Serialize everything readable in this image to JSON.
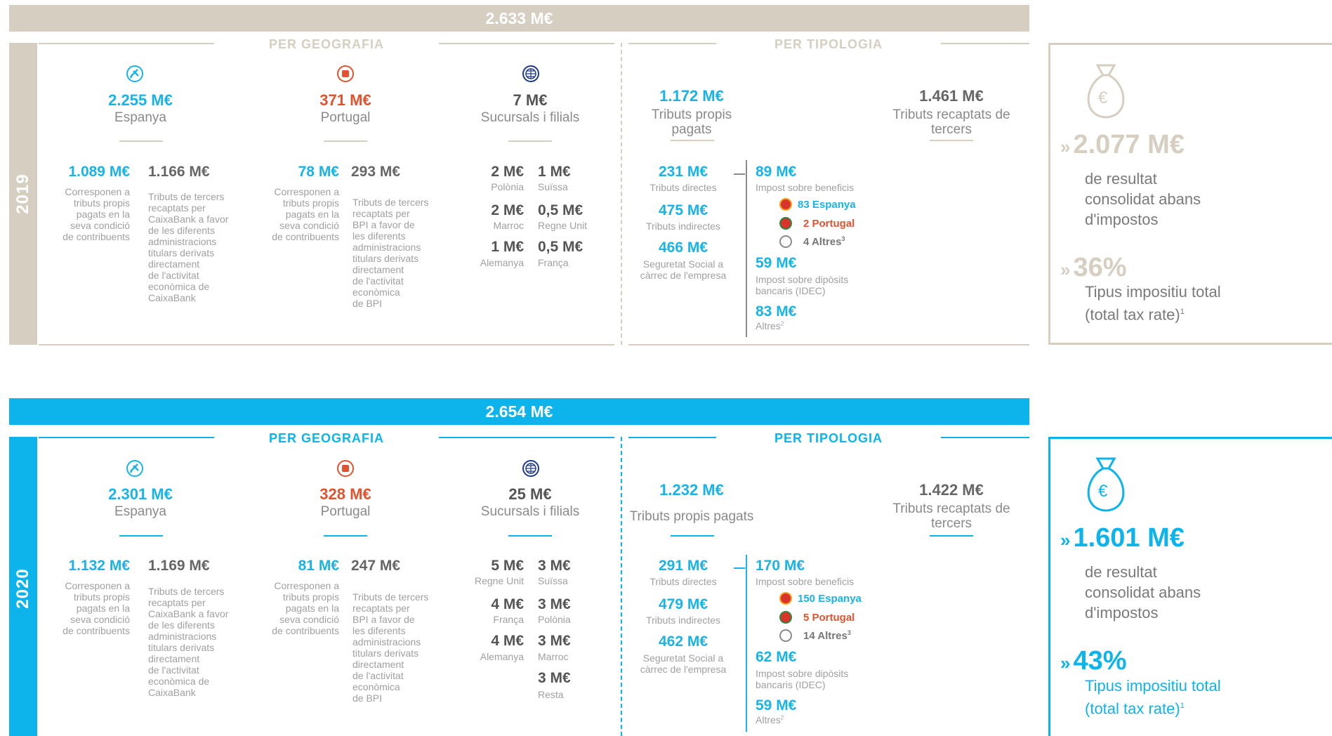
{
  "colors": {
    "y2019": "#d6cec1",
    "y2020": "#0db4ec",
    "blue": "#19b3e8",
    "orange": "#e0532e",
    "dark": "#555555",
    "gray": "#a0a0a0",
    "navy": "#1f3a8a"
  },
  "icons": {
    "spain": "plane-icon",
    "portugal": "portugal-icon",
    "world": "globe-icon",
    "moneybag": "money-bag-icon"
  },
  "common": {
    "per_geografia": "PER GEOGRAFIA",
    "per_tipologia": "PER TIPOLOGIA",
    "espanya": "Espanya",
    "portugal": "Portugal",
    "sucursals": "Sucursals i filials",
    "tributs_propis_2019": "Tributs propis\npagats",
    "tributs_propis_2020": "Tributs propis pagats",
    "tributs_recaptats": "Tributs recaptats de\ntercers",
    "corresponen": "Corresponen a\ntributs propis\npagats en la\nseva condició\nde contribuents",
    "caixa_tercers": "Tributs de tercers\nrecaptats per\nCaixaBank a favor\nde les diferents\nadministracions\ntitulars derivats\ndirectament\nde l'activitat\neconòmica de\nCaixaBank",
    "bpi_tercers": "Tributs de tercers\nrecaptats per\nBPI a favor de\nles diferents\nadministracions\ntitulars derivats\ndirectament\nde l'activitat\neconòmica\nde BPI",
    "tributs_directes": "Tributs directes",
    "tributs_indirectes": "Tributs indirectes",
    "seguretat": "Seguretat Social a\ncàrrec de l'empresa",
    "impost_benefic": "Impost sobre beneficis",
    "impost_diposits": "Impost sobre dipòsits\nbancaris (IDEC)",
    "altres": "Altres",
    "altres_sup": "2",
    "resultat": "de resultat\nconsolidat abans\nd'impostos",
    "tipus": "Tipus impositiu total\n(total tax rate)",
    "tipus_sup": "1",
    "chevron": "»"
  },
  "y2019": {
    "year": "2019",
    "total": "2.633 M€",
    "espanya_total": "2.255 M€",
    "portugal_total": "371 M€",
    "sucursals_total": "7 M€",
    "es_propis": "1.089 M€",
    "es_tercers": "1.166 M€",
    "pt_propis": "78 M€",
    "pt_tercers": "293 M€",
    "sub": [
      {
        "v1": "2 M€",
        "l1": "Polònia",
        "v2": "1 M€",
        "l2": "Suïssa"
      },
      {
        "v1": "2 M€",
        "l1": "Marroc",
        "v2": "0,5 M€",
        "l2": "Regne Unit"
      },
      {
        "v1": "1 M€",
        "l1": "Alemanya",
        "v2": "0,5 M€",
        "l2": "França"
      }
    ],
    "propis_total": "1.172 M€",
    "recaptats_total": "1.461 M€",
    "directes": "231 M€",
    "indirectes": "475 M€",
    "seguretat_v": "466 M€",
    "benefic": "89 M€",
    "flags": [
      "83 Espanya",
      "2 Portugal",
      "4 Altres"
    ],
    "flag_sup": "3",
    "diposits": "59 M€",
    "altres_v": "83 M€",
    "resultat_v": "2.077 M€",
    "tipus_v": "36%"
  },
  "y2020": {
    "year": "2020",
    "total": "2.654 M€",
    "espanya_total": "2.301 M€",
    "portugal_total": "328 M€",
    "sucursals_total": "25 M€",
    "es_propis": "1.132 M€",
    "es_tercers": "1.169 M€",
    "pt_propis": "81 M€",
    "pt_tercers": "247 M€",
    "sub": [
      {
        "v1": "5 M€",
        "l1": "Regne Unit",
        "v2": "3 M€",
        "l2": "Suïssa"
      },
      {
        "v1": "4 M€",
        "l1": "França",
        "v2": "3 M€",
        "l2": "Polònia"
      },
      {
        "v1": "4 M€",
        "l1": "Alemanya",
        "v2": "3 M€",
        "l2": "Marroc"
      }
    ],
    "resta_v": "3 M€",
    "resta_l": "Resta",
    "propis_total": "1.232 M€",
    "recaptats_total": "1.422 M€",
    "directes": "291 M€",
    "indirectes": "479 M€",
    "seguretat_v": "462 M€",
    "benefic": "170 M€",
    "flags": [
      "150 Espanya",
      "5 Portugal",
      "14 Altres"
    ],
    "flag_sup": "3",
    "diposits": "62 M€",
    "altres_v": "59 M€",
    "resultat_v": "1.601 M€",
    "tipus_v": "43%"
  }
}
